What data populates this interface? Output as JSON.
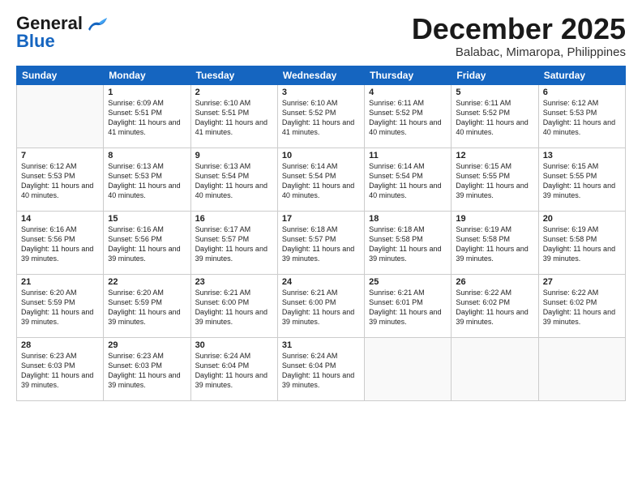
{
  "header": {
    "logo_general": "General",
    "logo_blue": "Blue",
    "month_title": "December 2025",
    "location": "Balabac, Mimaropa, Philippines"
  },
  "days_of_week": [
    "Sunday",
    "Monday",
    "Tuesday",
    "Wednesday",
    "Thursday",
    "Friday",
    "Saturday"
  ],
  "weeks": [
    [
      {
        "day": "",
        "sunrise": "",
        "sunset": "",
        "daylight": ""
      },
      {
        "day": "1",
        "sunrise": "Sunrise: 6:09 AM",
        "sunset": "Sunset: 5:51 PM",
        "daylight": "Daylight: 11 hours and 41 minutes."
      },
      {
        "day": "2",
        "sunrise": "Sunrise: 6:10 AM",
        "sunset": "Sunset: 5:51 PM",
        "daylight": "Daylight: 11 hours and 41 minutes."
      },
      {
        "day": "3",
        "sunrise": "Sunrise: 6:10 AM",
        "sunset": "Sunset: 5:52 PM",
        "daylight": "Daylight: 11 hours and 41 minutes."
      },
      {
        "day": "4",
        "sunrise": "Sunrise: 6:11 AM",
        "sunset": "Sunset: 5:52 PM",
        "daylight": "Daylight: 11 hours and 40 minutes."
      },
      {
        "day": "5",
        "sunrise": "Sunrise: 6:11 AM",
        "sunset": "Sunset: 5:52 PM",
        "daylight": "Daylight: 11 hours and 40 minutes."
      },
      {
        "day": "6",
        "sunrise": "Sunrise: 6:12 AM",
        "sunset": "Sunset: 5:53 PM",
        "daylight": "Daylight: 11 hours and 40 minutes."
      }
    ],
    [
      {
        "day": "7",
        "sunrise": "Sunrise: 6:12 AM",
        "sunset": "Sunset: 5:53 PM",
        "daylight": "Daylight: 11 hours and 40 minutes."
      },
      {
        "day": "8",
        "sunrise": "Sunrise: 6:13 AM",
        "sunset": "Sunset: 5:53 PM",
        "daylight": "Daylight: 11 hours and 40 minutes."
      },
      {
        "day": "9",
        "sunrise": "Sunrise: 6:13 AM",
        "sunset": "Sunset: 5:54 PM",
        "daylight": "Daylight: 11 hours and 40 minutes."
      },
      {
        "day": "10",
        "sunrise": "Sunrise: 6:14 AM",
        "sunset": "Sunset: 5:54 PM",
        "daylight": "Daylight: 11 hours and 40 minutes."
      },
      {
        "day": "11",
        "sunrise": "Sunrise: 6:14 AM",
        "sunset": "Sunset: 5:54 PM",
        "daylight": "Daylight: 11 hours and 40 minutes."
      },
      {
        "day": "12",
        "sunrise": "Sunrise: 6:15 AM",
        "sunset": "Sunset: 5:55 PM",
        "daylight": "Daylight: 11 hours and 39 minutes."
      },
      {
        "day": "13",
        "sunrise": "Sunrise: 6:15 AM",
        "sunset": "Sunset: 5:55 PM",
        "daylight": "Daylight: 11 hours and 39 minutes."
      }
    ],
    [
      {
        "day": "14",
        "sunrise": "Sunrise: 6:16 AM",
        "sunset": "Sunset: 5:56 PM",
        "daylight": "Daylight: 11 hours and 39 minutes."
      },
      {
        "day": "15",
        "sunrise": "Sunrise: 6:16 AM",
        "sunset": "Sunset: 5:56 PM",
        "daylight": "Daylight: 11 hours and 39 minutes."
      },
      {
        "day": "16",
        "sunrise": "Sunrise: 6:17 AM",
        "sunset": "Sunset: 5:57 PM",
        "daylight": "Daylight: 11 hours and 39 minutes."
      },
      {
        "day": "17",
        "sunrise": "Sunrise: 6:18 AM",
        "sunset": "Sunset: 5:57 PM",
        "daylight": "Daylight: 11 hours and 39 minutes."
      },
      {
        "day": "18",
        "sunrise": "Sunrise: 6:18 AM",
        "sunset": "Sunset: 5:58 PM",
        "daylight": "Daylight: 11 hours and 39 minutes."
      },
      {
        "day": "19",
        "sunrise": "Sunrise: 6:19 AM",
        "sunset": "Sunset: 5:58 PM",
        "daylight": "Daylight: 11 hours and 39 minutes."
      },
      {
        "day": "20",
        "sunrise": "Sunrise: 6:19 AM",
        "sunset": "Sunset: 5:58 PM",
        "daylight": "Daylight: 11 hours and 39 minutes."
      }
    ],
    [
      {
        "day": "21",
        "sunrise": "Sunrise: 6:20 AM",
        "sunset": "Sunset: 5:59 PM",
        "daylight": "Daylight: 11 hours and 39 minutes."
      },
      {
        "day": "22",
        "sunrise": "Sunrise: 6:20 AM",
        "sunset": "Sunset: 5:59 PM",
        "daylight": "Daylight: 11 hours and 39 minutes."
      },
      {
        "day": "23",
        "sunrise": "Sunrise: 6:21 AM",
        "sunset": "Sunset: 6:00 PM",
        "daylight": "Daylight: 11 hours and 39 minutes."
      },
      {
        "day": "24",
        "sunrise": "Sunrise: 6:21 AM",
        "sunset": "Sunset: 6:00 PM",
        "daylight": "Daylight: 11 hours and 39 minutes."
      },
      {
        "day": "25",
        "sunrise": "Sunrise: 6:21 AM",
        "sunset": "Sunset: 6:01 PM",
        "daylight": "Daylight: 11 hours and 39 minutes."
      },
      {
        "day": "26",
        "sunrise": "Sunrise: 6:22 AM",
        "sunset": "Sunset: 6:02 PM",
        "daylight": "Daylight: 11 hours and 39 minutes."
      },
      {
        "day": "27",
        "sunrise": "Sunrise: 6:22 AM",
        "sunset": "Sunset: 6:02 PM",
        "daylight": "Daylight: 11 hours and 39 minutes."
      }
    ],
    [
      {
        "day": "28",
        "sunrise": "Sunrise: 6:23 AM",
        "sunset": "Sunset: 6:03 PM",
        "daylight": "Daylight: 11 hours and 39 minutes."
      },
      {
        "day": "29",
        "sunrise": "Sunrise: 6:23 AM",
        "sunset": "Sunset: 6:03 PM",
        "daylight": "Daylight: 11 hours and 39 minutes."
      },
      {
        "day": "30",
        "sunrise": "Sunrise: 6:24 AM",
        "sunset": "Sunset: 6:04 PM",
        "daylight": "Daylight: 11 hours and 39 minutes."
      },
      {
        "day": "31",
        "sunrise": "Sunrise: 6:24 AM",
        "sunset": "Sunset: 6:04 PM",
        "daylight": "Daylight: 11 hours and 39 minutes."
      },
      {
        "day": "",
        "sunrise": "",
        "sunset": "",
        "daylight": ""
      },
      {
        "day": "",
        "sunrise": "",
        "sunset": "",
        "daylight": ""
      },
      {
        "day": "",
        "sunrise": "",
        "sunset": "",
        "daylight": ""
      }
    ]
  ]
}
